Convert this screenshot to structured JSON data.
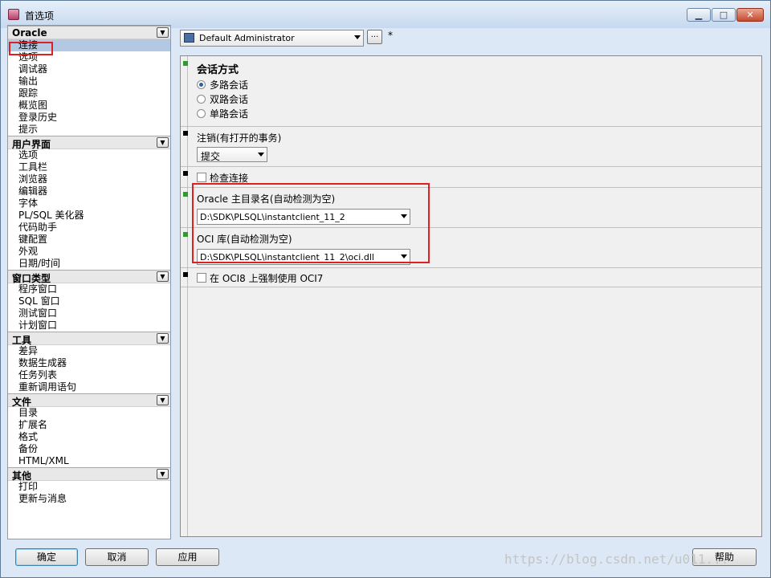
{
  "window": {
    "title": "首选项"
  },
  "nav_groups": [
    {
      "title": "Oracle",
      "items": [
        "连接",
        "选项",
        "调试器",
        "输出",
        "跟踪",
        "概览图",
        "登录历史",
        "提示"
      ]
    },
    {
      "title": "用户界面",
      "items": [
        "选项",
        "工具栏",
        "浏览器",
        "编辑器",
        "字体",
        "PL/SQL 美化器",
        "代码助手",
        "键配置",
        "外观",
        "日期/时间"
      ]
    },
    {
      "title": "窗口类型",
      "items": [
        "程序窗口",
        "SQL 窗口",
        "测试窗口",
        "计划窗口"
      ]
    },
    {
      "title": "工具",
      "items": [
        "差异",
        "数据生成器",
        "任务列表",
        "重新调用语句"
      ]
    },
    {
      "title": "文件",
      "items": [
        "目录",
        "扩展名",
        "格式",
        "备份",
        "HTML/XML"
      ]
    },
    {
      "title": "其他",
      "items": [
        "打印",
        "更新与消息"
      ]
    }
  ],
  "profile": {
    "selected": "Default Administrator",
    "more_label": "...",
    "modified_marker": "*"
  },
  "session": {
    "title": "会话方式",
    "options": [
      "多路会话",
      "双路会话",
      "单路会话"
    ],
    "selected_index": 0
  },
  "logoff": {
    "label": "注销(有打开的事务)",
    "value": "提交"
  },
  "check_connection": {
    "label": "检查连接",
    "checked": false
  },
  "oracle_home": {
    "label": "Oracle 主目录名(自动检测为空)",
    "value": "D:\\SDK\\PLSQL\\instantclient_11_2"
  },
  "oci_library": {
    "label": "OCI 库(自动检测为空)",
    "value": "D:\\SDK\\PLSQL\\instantclient_11_2\\oci.dll"
  },
  "force_oci7": {
    "label": "在 OCI8 上强制使用 OCI7",
    "checked": false
  },
  "buttons": {
    "ok": "确定",
    "cancel": "取消",
    "apply": "应用",
    "help": "帮助"
  },
  "watermark": "https://blog.csdn.net/u011..."
}
